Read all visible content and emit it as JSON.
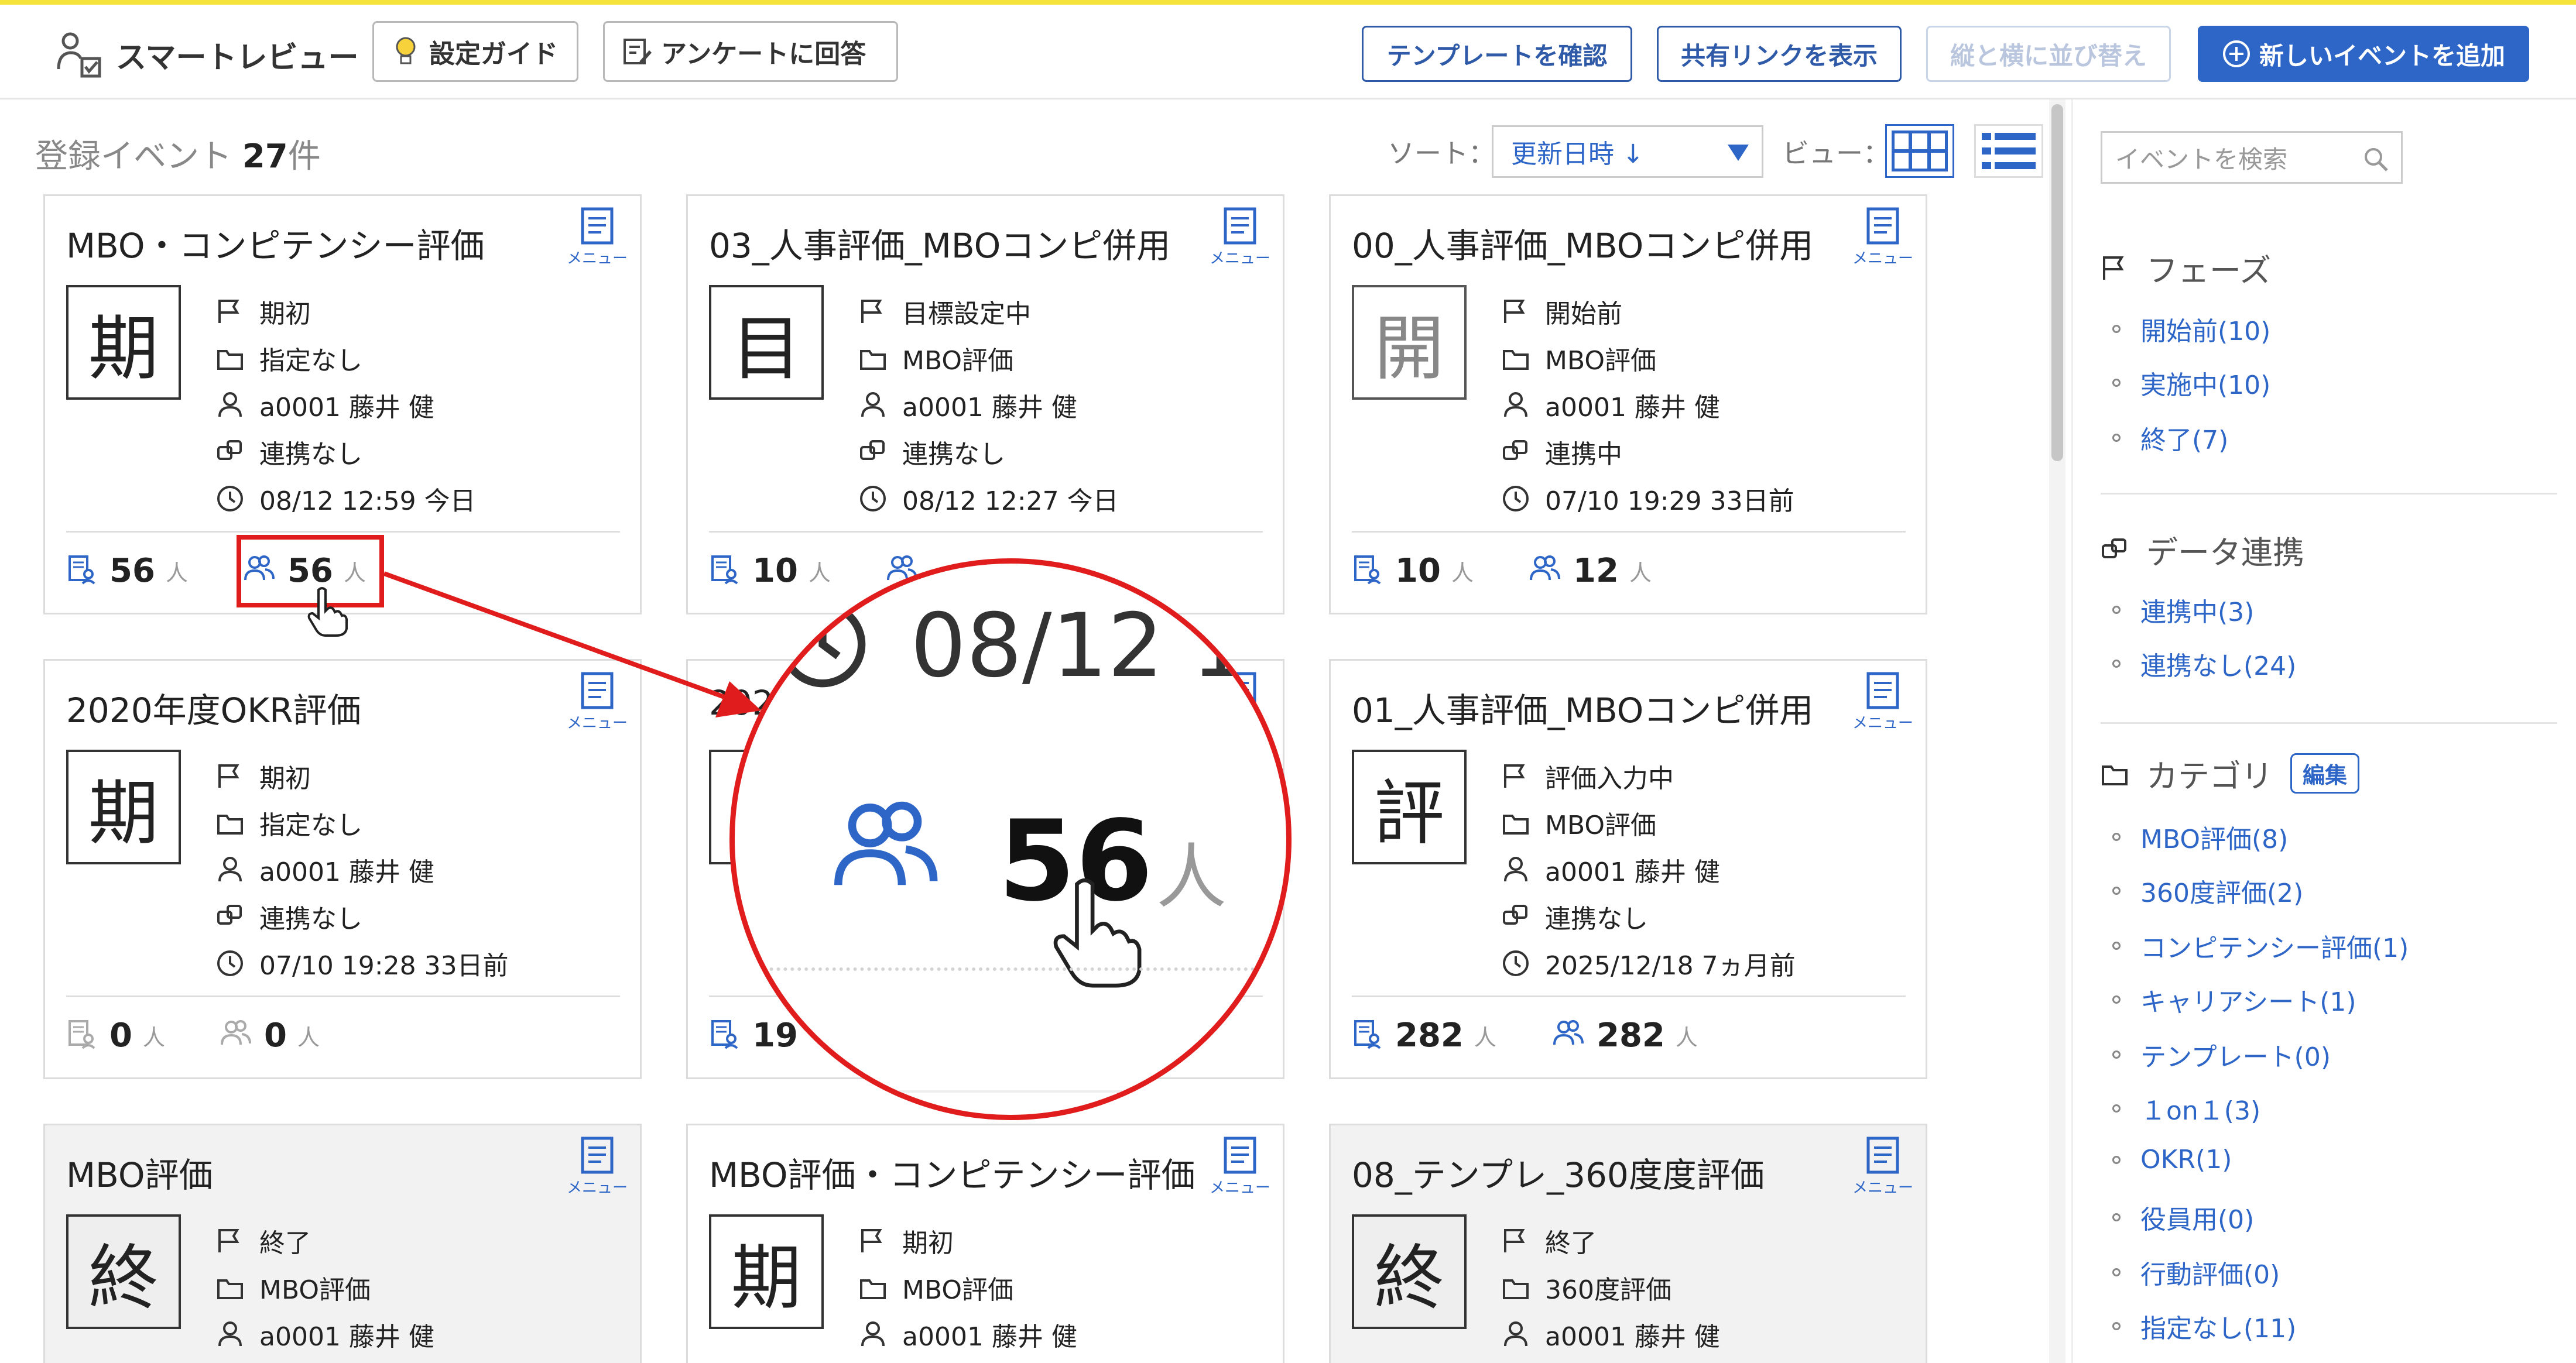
{
  "header": {
    "app_title": "スマートレビュー",
    "guide_label": "設定ガイド",
    "survey_label": "アンケートに回答",
    "template_label": "テンプレートを確認",
    "share_label": "共有リンクを表示",
    "reorder_label": "縦と横に並び替え",
    "add_label": "新しいイベントを追加"
  },
  "toolbar": {
    "count_prefix": "登録イベント",
    "count_value": "27",
    "count_suffix": "件",
    "sort_label": "ソート：",
    "sort_value": "更新日時 ↓",
    "view_label": "ビュー："
  },
  "menu_label": "メニュー",
  "person_unit": "人",
  "cards": [
    {
      "title": "MBO・コンピテンシー評価",
      "phase_char": "期",
      "phase": "期初",
      "category": "指定なし",
      "owner": "a0001 藤井 健",
      "link": "連携なし",
      "updated": "08/12 12:59 今日",
      "sheets": "56",
      "people": "56"
    },
    {
      "title": "03_人事評価_MBOコンピ併用",
      "phase_char": "目",
      "phase": "目標設定中",
      "category": "MBO評価",
      "owner": "a0001 藤井 健",
      "link": "連携なし",
      "updated": "08/12 12:27 今日",
      "sheets": "10",
      "people": ""
    },
    {
      "title": "00_人事評価_MBOコンピ併用",
      "phase_char": "開",
      "phase": "開始前",
      "category": "MBO評価",
      "owner": "a0001 藤井 健",
      "link": "連携中",
      "updated": "07/10 19:29 33日前",
      "sheets": "10",
      "people": "12"
    },
    {
      "title": "2020年度OKR評価",
      "phase_char": "期",
      "phase": "期初",
      "category": "指定なし",
      "owner": "a0001 藤井 健",
      "link": "連携なし",
      "updated": "07/10 19:28 33日前",
      "sheets": "0",
      "people": "0"
    },
    {
      "title": "202",
      "phase_char": "",
      "phase": "",
      "category": "",
      "owner": "",
      "link": "",
      "updated": "",
      "sheets": "19",
      "people": ""
    },
    {
      "title": "01_人事評価_MBOコンピ併用",
      "phase_char": "評",
      "phase": "評価入力中",
      "category": "MBO評価",
      "owner": "a0001 藤井 健",
      "link": "連携なし",
      "updated": "2025/12/18 7ヵ月前",
      "sheets": "282",
      "people": "282"
    },
    {
      "title": "MBO評価",
      "phase_char": "終",
      "phase": "終了",
      "category": "MBO評価",
      "owner": "a0001 藤井 健"
    },
    {
      "title": "MBO評価・コンピテンシー評価",
      "phase_char": "期",
      "phase": "期初",
      "category": "MBO評価",
      "owner": "a0001 藤井 健"
    },
    {
      "title": "08_テンプレ_360度度評価",
      "phase_char": "終",
      "phase": "終了",
      "category": "360度評価",
      "owner": "a0001 藤井 健"
    }
  ],
  "zoom": {
    "date": "08/12 1:",
    "number": "56",
    "unit": "人"
  },
  "right_panel": {
    "search_placeholder": "イベントを検索",
    "phase_title": "フェーズ",
    "phase_items": [
      "開始前(10)",
      "実施中(10)",
      "終了(7)"
    ],
    "link_title": "データ連携",
    "link_items": [
      "連携中(3)",
      "連携なし(24)"
    ],
    "category_title": "カテゴリ",
    "edit_label": "編集",
    "category_items": [
      "MBO評価(8)",
      "360度評価(2)",
      "コンピテンシー評価(1)",
      "キャリアシート(1)",
      "テンプレート(0)",
      "１on１(3)",
      "OKR(1)",
      "役員用(0)",
      "行動評価(0)",
      "指定なし(11)"
    ]
  },
  "colors": {
    "accent": "#2e66c8",
    "highlight": "#e01c1c",
    "topline": "#f5e23b"
  }
}
